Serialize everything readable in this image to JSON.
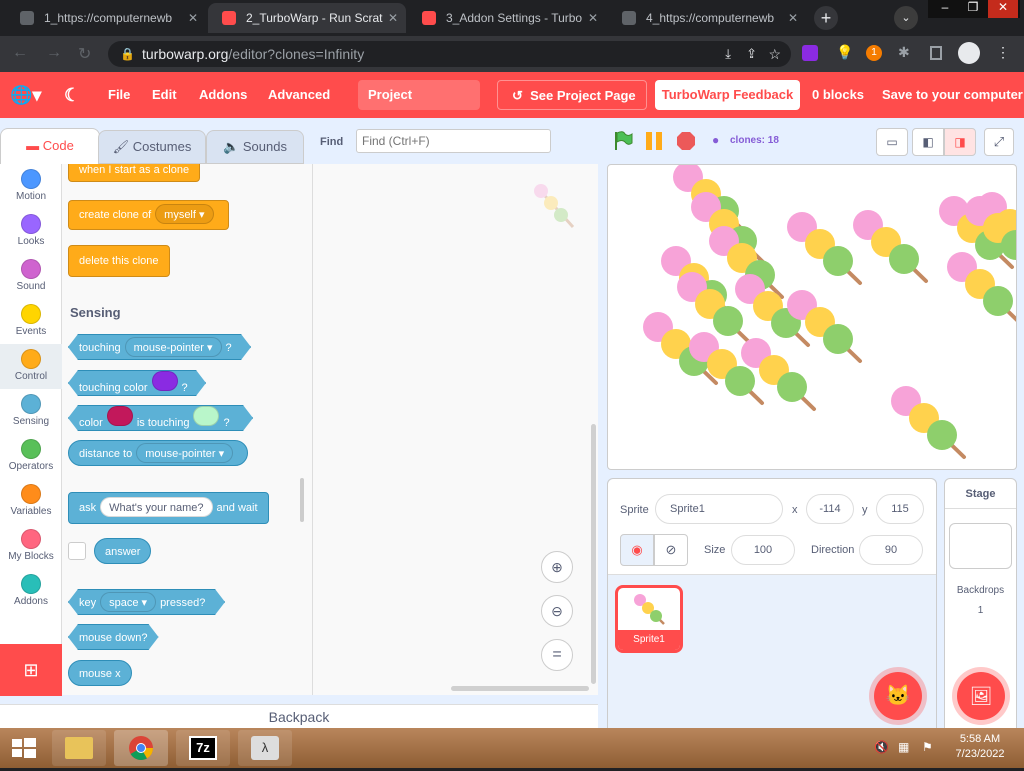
{
  "browser": {
    "tabs": [
      {
        "label": "1_https://computernewb",
        "active": false
      },
      {
        "label": "2_TurboWarp - Run Scrat",
        "active": true
      },
      {
        "label": "3_Addon Settings - Turbo",
        "active": false
      },
      {
        "label": "4_https://computernewb",
        "active": false
      }
    ],
    "url_host": "turbowarp.org",
    "url_path": "/editor?clones=Infinity",
    "ext_badge": "1"
  },
  "menubar": {
    "file": "File",
    "edit": "Edit",
    "addons": "Addons",
    "advanced": "Advanced",
    "project_title": "Project",
    "see_project": "See Project Page",
    "feedback": "TurboWarp Feedback",
    "blocks": "0 blocks",
    "save": "Save to your computer"
  },
  "editor_tabs": {
    "code": "Code",
    "costumes": "Costumes",
    "sounds": "Sounds"
  },
  "find": {
    "label": "Find",
    "placeholder": "Find (Ctrl+F)"
  },
  "clones": "clones: 18",
  "categories": [
    {
      "label": "Motion",
      "color": "#4c97ff"
    },
    {
      "label": "Looks",
      "color": "#9966ff"
    },
    {
      "label": "Sound",
      "color": "#cf63cf"
    },
    {
      "label": "Events",
      "color": "#ffd500"
    },
    {
      "label": "Control",
      "color": "#ffab19"
    },
    {
      "label": "Sensing",
      "color": "#5cb1d6"
    },
    {
      "label": "Operators",
      "color": "#59c059"
    },
    {
      "label": "Variables",
      "color": "#ff8c1a"
    },
    {
      "label": "My Blocks",
      "color": "#ff6680"
    },
    {
      "label": "Addons",
      "color": "#29beb8"
    }
  ],
  "palette": {
    "when_clone": "when I start as a clone",
    "create_clone": "create clone of",
    "myself": "myself",
    "delete_clone": "delete this clone",
    "sensing_header": "Sensing",
    "touching": "touching",
    "mouse_pointer": "mouse-pointer",
    "q": "?",
    "touching_color": "touching color",
    "color": "color",
    "is_touching": "is touching",
    "distance_to": "distance to",
    "ask": "ask",
    "whats_name": "What's your name?",
    "and_wait": "and wait",
    "answer": "answer",
    "key": "key",
    "space": "space",
    "pressed": "pressed?",
    "mouse_down": "mouse down?",
    "mouse_x": "mouse x"
  },
  "sprite": {
    "label": "Sprite",
    "name": "Sprite1",
    "x_label": "x",
    "x": "-114",
    "y_label": "y",
    "y": "115",
    "size_label": "Size",
    "size": "100",
    "direction_label": "Direction",
    "direction": "90",
    "thumb_name": "Sprite1"
  },
  "stage_panel": {
    "title": "Stage",
    "backdrops_label": "Backdrops",
    "backdrops_count": "1"
  },
  "backpack": "Backpack",
  "taskbar": {
    "time": "5:58 AM",
    "date": "7/23/2022"
  },
  "colors": {
    "accent": "#ff4c4c",
    "control": "#ffab19",
    "sensing": "#5cb1d6"
  }
}
